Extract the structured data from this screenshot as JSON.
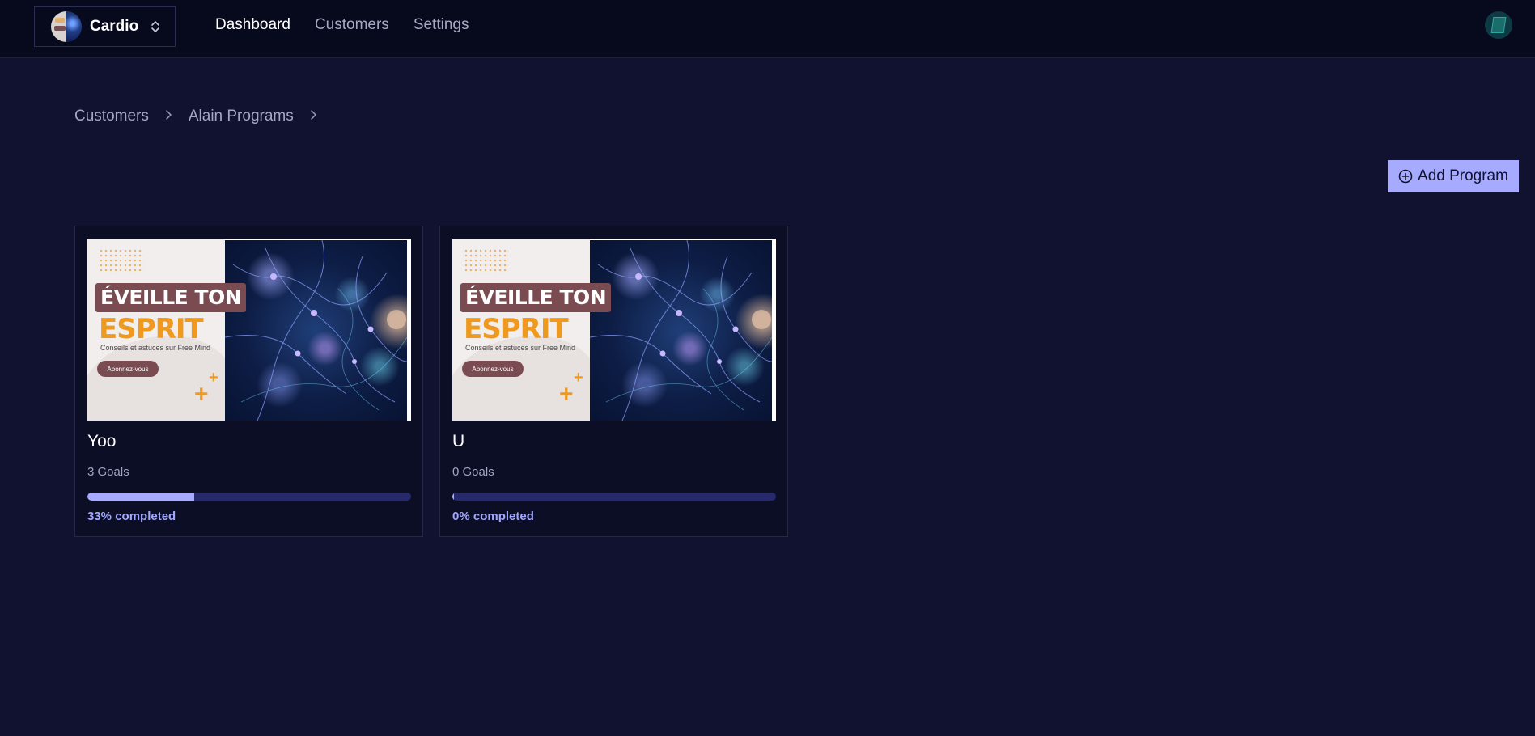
{
  "topbar": {
    "team_name": "Cardio",
    "nav": [
      {
        "label": "Dashboard",
        "active": true
      },
      {
        "label": "Customers",
        "active": false
      },
      {
        "label": "Settings",
        "active": false
      }
    ]
  },
  "breadcrumb": [
    "Customers",
    "Alain Programs"
  ],
  "actions": {
    "add_program_label": "Add Program"
  },
  "programs": [
    {
      "title": "Yoo",
      "goals": "3 Goals",
      "progress": 0.33,
      "completed_text": "33% completed",
      "thumbnail": {
        "banner": "ÉVEILLE TON",
        "headline": "ESPRIT",
        "tagline": "Conseils et astuces sur Free Mind",
        "button": "Abonnez-vous"
      }
    },
    {
      "title": "U",
      "goals": "0 Goals",
      "progress": 0.0,
      "completed_text": "0% completed",
      "thumbnail": {
        "banner": "ÉVEILLE TON",
        "headline": "ESPRIT",
        "tagline": "Conseils et astuces sur Free Mind",
        "button": "Abonnez-vous"
      }
    }
  ],
  "colors": {
    "background": "#10122f",
    "topbar": "#070a1d",
    "accent": "#a7abff",
    "progress_track": "#26296a",
    "thumbnail_orange": "#ef9a1f",
    "thumbnail_maroon": "#7a4c52"
  },
  "icons": {
    "team_switch": "chevron-up-down-icon",
    "add": "plus-circle-icon",
    "breadcrumb_separator": "chevron-right-icon"
  }
}
